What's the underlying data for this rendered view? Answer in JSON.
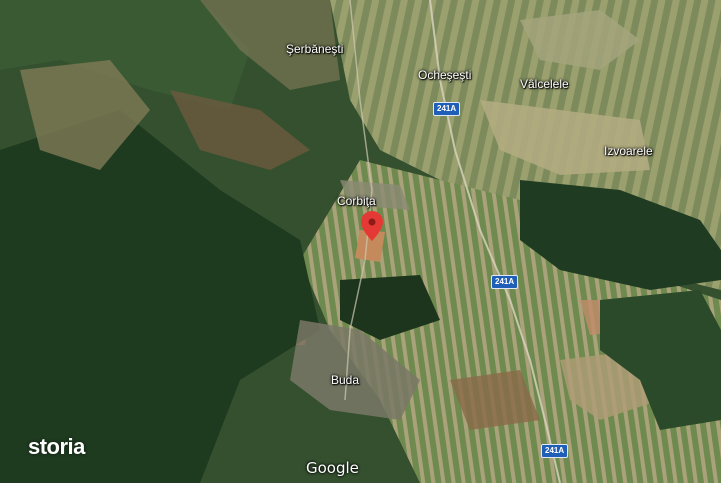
{
  "map": {
    "view": "satellite",
    "places": {
      "serbanesti": "Şerbăneşti",
      "ochesesti": "Ocheşeşti",
      "valcelele": "Vâlcelele",
      "izvoarele": "Izvoarele",
      "corbita": "Corbiţa",
      "buda": "Buda"
    },
    "roads": {
      "shield_1": "241A",
      "shield_2": "241A",
      "shield_3": "241A"
    },
    "marker_color": "#e53935"
  },
  "branding": {
    "watermark": "storia",
    "attribution": "Google"
  }
}
